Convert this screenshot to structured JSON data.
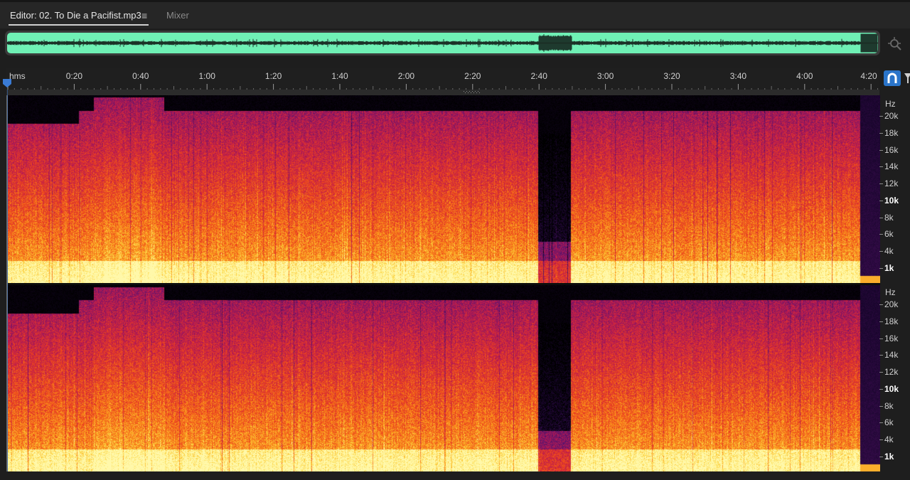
{
  "tabs": [
    {
      "label": "Editor: 02. To Die a Pacifist.mp3",
      "active": true
    },
    {
      "label": "Mixer",
      "active": false
    }
  ],
  "tab_menu_glyph": "≡",
  "ruler": {
    "unit": "hms",
    "labels": [
      "0:20",
      "0:40",
      "1:00",
      "1:20",
      "1:40",
      "2:00",
      "2:20",
      "2:40",
      "3:00",
      "3:20",
      "3:40",
      "4:00",
      "4:20"
    ],
    "label_seconds": [
      20,
      40,
      60,
      80,
      100,
      120,
      140,
      160,
      180,
      200,
      220,
      240,
      260
    ]
  },
  "frequency_scale": {
    "unit": "Hz",
    "labels": [
      "20k",
      "18k",
      "16k",
      "14k",
      "12k",
      "10k",
      "8k",
      "6k",
      "4k",
      "1k"
    ],
    "major": [
      "10k",
      "1k"
    ]
  },
  "channels": [
    "channel-1",
    "channel-2"
  ],
  "colors": {
    "overview_waveform": "#6ff0b5",
    "snap_button": "#2a74c9",
    "playhead": "#3a7bd5"
  },
  "icons": {
    "zoom_overview": "zoom-magnifier-icon",
    "snap": "magnet-icon",
    "filter": "funnel-icon",
    "playhead": "playhead-marker-icon"
  }
}
